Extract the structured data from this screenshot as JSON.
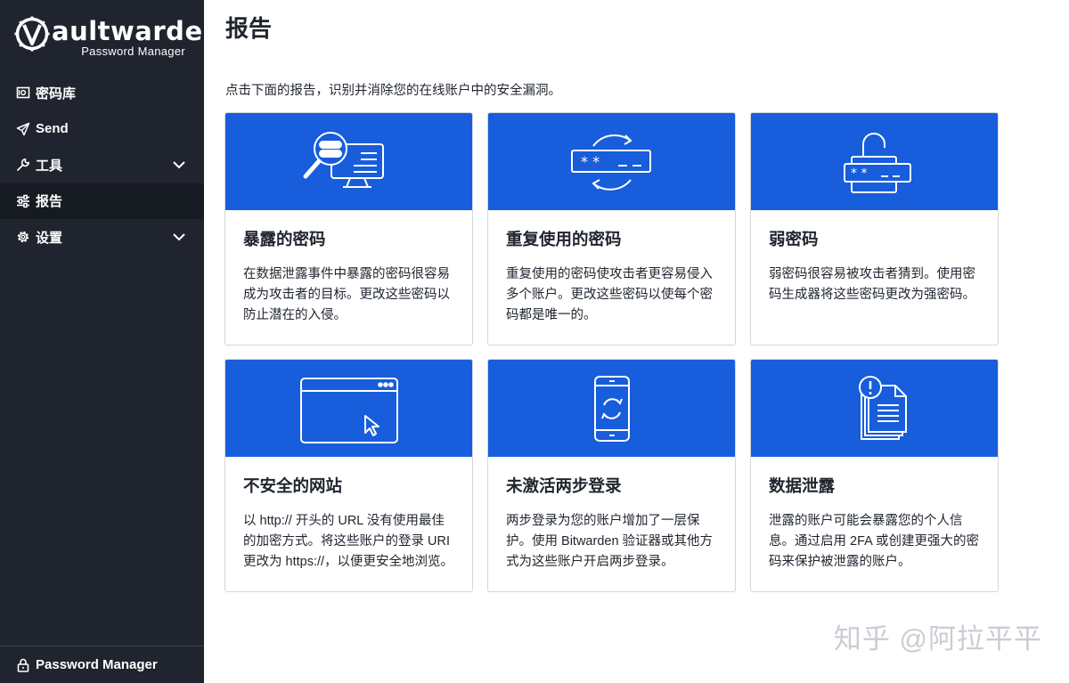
{
  "app": {
    "logo_bold": "aultwarden",
    "logo_prefix": "V",
    "logo_sub": "Password Manager"
  },
  "sidebar": {
    "items": [
      {
        "label": "密码库",
        "icon": "vault-icon"
      },
      {
        "label": "Send",
        "icon": "send-icon"
      },
      {
        "label": "工具",
        "icon": "wrench-icon",
        "has_chevron": true
      },
      {
        "label": "报告",
        "icon": "sliders-icon",
        "active": true
      },
      {
        "label": "设置",
        "icon": "gear-icon",
        "has_chevron": true
      }
    ],
    "footer": {
      "label": "Password Manager",
      "icon": "lock-icon"
    }
  },
  "main": {
    "title": "报告",
    "intro": "点击下面的报告，识别并消除您的在线账户中的安全漏洞。",
    "cards": [
      {
        "title": "暴露的密码",
        "desc": "在数据泄露事件中暴露的密码很容易成为攻击者的目标。更改这些密码以防止潜在的入侵。",
        "icon": "exposed-password-icon"
      },
      {
        "title": "重复使用的密码",
        "desc": "重复使用的密码使攻击者更容易侵入多个账户。更改这些密码以使每个密码都是唯一的。",
        "icon": "reused-password-icon"
      },
      {
        "title": "弱密码",
        "desc": "弱密码很容易被攻击者猜到。使用密码生成器将这些密码更改为强密码。",
        "icon": "weak-password-icon"
      },
      {
        "title": "不安全的网站",
        "desc": "以 http:// 开头的 URL 没有使用最佳的加密方式。将这些账户的登录 URI 更改为 https://，以便更安全地浏览。",
        "icon": "unsecured-website-icon"
      },
      {
        "title": "未激活两步登录",
        "desc": "两步登录为您的账户增加了一层保护。使用 Bitwarden 验证器或其他方式为这些账户开启两步登录。",
        "icon": "two-step-login-icon"
      },
      {
        "title": "数据泄露",
        "desc": "泄露的账户可能会暴露您的个人信息。通过启用 2FA 或创建更强大的密码来保护被泄露的账户。",
        "icon": "data-breach-icon"
      }
    ]
  },
  "watermark": "知乎 @阿拉平平",
  "colors": {
    "sidebar_bg": "#1f242e",
    "accent": "#175ddc"
  }
}
